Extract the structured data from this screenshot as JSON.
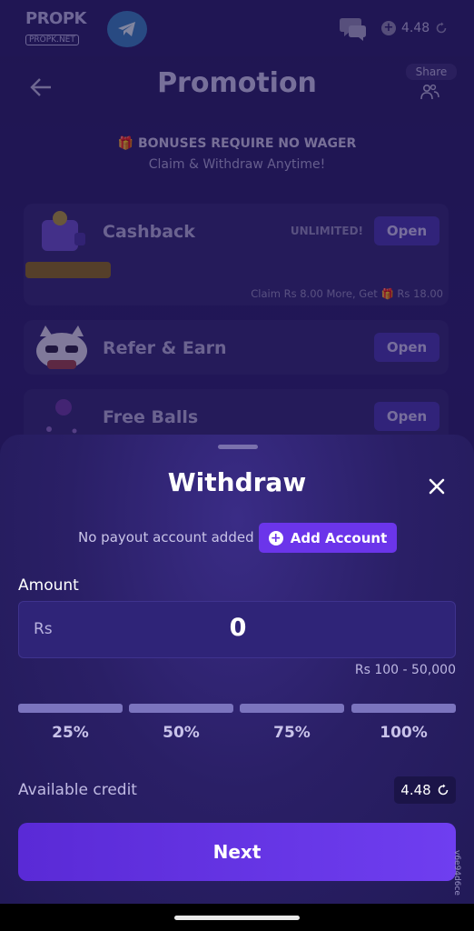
{
  "app": {
    "logo_text": "PROPK",
    "logo_subtext": "PROPK.NET",
    "balance": "4.48"
  },
  "promotion": {
    "title": "Promotion",
    "share_label": "Share",
    "bonus_title": "🎁 BONUSES REQUIRE NO WAGER",
    "bonus_subtitle": "Claim & Withdraw Anytime!",
    "cards": [
      {
        "label": "Cashback",
        "badge": "UNLIMITED!",
        "button": "Open",
        "progress": 0.2,
        "claim_text": "Claim Rs 8.00 More, Get 🎁 Rs 18.00"
      },
      {
        "label": "Refer & Earn",
        "button": "Open"
      },
      {
        "label": "Free Balls",
        "button": "Open"
      }
    ]
  },
  "withdraw": {
    "title": "Withdraw",
    "no_payout_text": "No payout account added",
    "add_account_label": "Add Account",
    "amount_label": "Amount",
    "currency": "Rs",
    "amount_value": "0",
    "range_text": "Rs 100 - 50,000",
    "percent_options": [
      "25%",
      "50%",
      "75%",
      "100%"
    ],
    "available_credit_label": "Available credit",
    "available_credit_value": "4.48",
    "next_label": "Next"
  },
  "version": "v6e94d6ce",
  "colors": {
    "accent": "#6b35ea",
    "sheet_bg": "#2a1f66",
    "button_gradient_start": "#5a2ad6"
  }
}
